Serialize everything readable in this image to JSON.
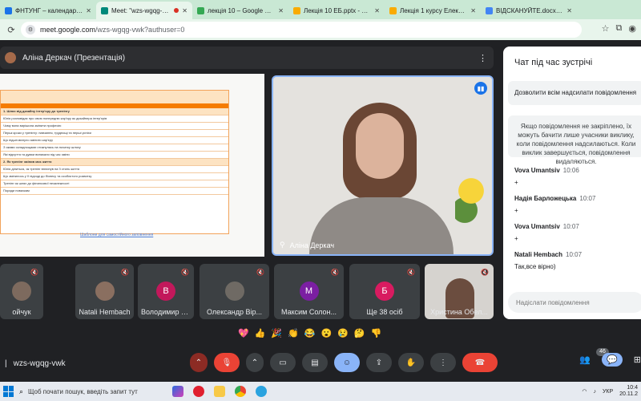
{
  "tabs": [
    {
      "label": "ФНТУНГ – календар - 4 c...",
      "color": "#1a73e8",
      "active": false
    },
    {
      "label": "Meet: \"wzs-wgqg-vwk\"",
      "color": "#00897b",
      "active": true
    },
    {
      "label": "лекція 10 – Google Диск",
      "color": "#34a853",
      "active": false
    },
    {
      "label": "Лекція 10 ЕБ.pptx - Google...",
      "color": "#f9ab00",
      "active": false
    },
    {
      "label": "Лекція 1 курсу Електронн...",
      "color": "#f9ab00",
      "active": false
    },
    {
      "label": "ВІДСКАНУЙТЕ.docx - Goo...",
      "color": "#4285f4",
      "active": false
    }
  ],
  "address": {
    "host": "meet.google.com",
    "path": "/wzs-wgqg-vwk?authuser=0"
  },
  "presenter": {
    "label": "Аліна Деркач (Презентація)"
  },
  "slide": {
    "header": "Шаблони для самостійного заповнення",
    "rows": [
      {
        "text": "1. Шлях від дизайну інтер'єру до тренінгу",
        "section": true
      },
      {
        "text": "Юлія розповідає про свою попередню кар'єру як дизайнера інтер'єрів",
        "section": false
      },
      {
        "text": "Чому вона вирішила змінити професію",
        "section": false
      },
      {
        "text": "Перші кроки у тренінгу: навчання, труднощі та перші успіхи",
        "section": false
      },
      {
        "text": "Що підштовхнуло змінити кар'єру",
        "section": false
      },
      {
        "text": "З якими складнощами стикнулась на початку шляху",
        "section": false
      },
      {
        "text": "Які відчуття та думки виникали під час зміни",
        "section": false
      },
      {
        "text": "2. Як тренінг змінив моє життя",
        "section": true
      },
      {
        "text": "Юлія ділиться, як тренінг вплинув на її стиль життя",
        "section": false
      },
      {
        "text": "Що змінилось у її підході до бізнесу та особистого розвитку",
        "section": false
      },
      {
        "text": "Тренінг як шлях до фінансової незалежності",
        "section": false
      },
      {
        "text": "Поради новачкам",
        "section": false
      }
    ],
    "link": "Шаблони для самостійного заповнення"
  },
  "speaker": {
    "name": "Аліна Деркач"
  },
  "participants": [
    {
      "name": "ойчук",
      "kind": "photo",
      "color": "#7d6a5e"
    },
    {
      "name": "Natali Hembach",
      "kind": "photo",
      "color": "#8a6f60"
    },
    {
      "name": "Володимир Пр...",
      "kind": "letter",
      "letter": "В",
      "color": "#c2185b"
    },
    {
      "name": "Олександр Вір...",
      "kind": "photo",
      "color": "#6f6a64"
    },
    {
      "name": "Максим Солон...",
      "kind": "letter",
      "letter": "М",
      "color": "#7b1fa2"
    },
    {
      "name": "Ще 38 осіб",
      "kind": "letter",
      "letter": "Б",
      "color": "#d81b60"
    },
    {
      "name": "Христина Обел...",
      "kind": "camera",
      "color": "#6b4d3f"
    }
  ],
  "reactions": [
    "💖",
    "👍",
    "🎉",
    "👏",
    "😂",
    "😮",
    "😢",
    "🤔",
    "👎"
  ],
  "meeting_code": "wzs-wgqg-vwk",
  "people_count": "46",
  "chat": {
    "title": "Чат під час зустрічі",
    "allow_label": "Дозволити всім надсилати повідомлення",
    "notice": "Якщо повідомлення не закріплено, їх можуть бачити лише учасники виклику, коли повідомлення надсилаються. Коли виклик завершується, повідомлення видаляються.",
    "messages": [
      {
        "who": "Vova Umantsiv",
        "time": "10:06",
        "text": "+"
      },
      {
        "who": "Надія Барложецька",
        "time": "10:07",
        "text": "+"
      },
      {
        "who": "Vova Umantsiv",
        "time": "10:07",
        "text": "+"
      },
      {
        "who": "Natali Hembach",
        "time": "10:07",
        "text": "Так,все вірно)"
      }
    ],
    "input_placeholder": "Надіслати повідомлення"
  },
  "taskbar": {
    "search": "Щоб почати пошук, введіть запит тут",
    "lang": "УКР",
    "time": "10:4",
    "date": "20.11.2"
  }
}
